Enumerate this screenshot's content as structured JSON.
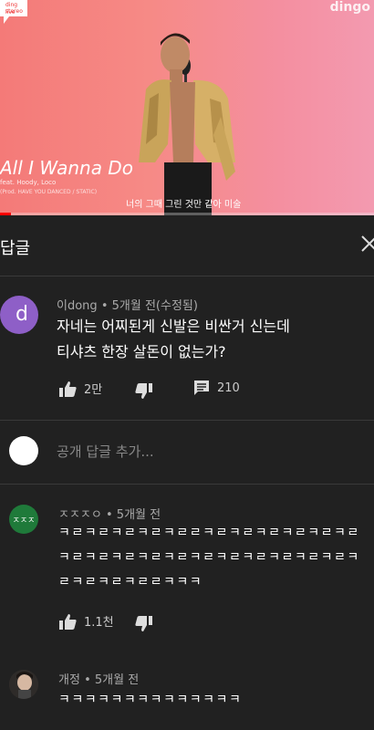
{
  "video": {
    "badge_line1": "ding stereo",
    "badge_line2": "live",
    "logo": "dingo",
    "song_title": "All I Wanna Do",
    "song_sub": "feat. Hoody, Loco",
    "song_credit": "(Prod. HAVE YOU DANCED / STATIC)",
    "subtitle": "너의 그때 그린 것만 같아 미술"
  },
  "header": {
    "title": "답글"
  },
  "main_comment": {
    "avatar_letter": "d",
    "avatar_color": "#8e5fc7",
    "author": "이dong",
    "time": "5개월 전(수정됨)",
    "line1": "자네는 어찌된게 신발은 비싼거 신는데",
    "line2": "티샤츠 한장 살돈이 없는가?",
    "likes": "2만",
    "replies": "210"
  },
  "reply_box": {
    "placeholder": "공개 답글 추가..."
  },
  "replies": [
    {
      "avatar_text": "ㅈㅈㅈ",
      "avatar_color": "#1f7a3a",
      "author": "ㅈㅈㅈㅇ",
      "time": "5개월 전",
      "line1": "ㅋㄹㅋㄹㅋㄹㅋㄹㅋㄹㄹㅋㄹㅋㄹㅋㄹㅋㄹㅋㄹㅋㄹ",
      "line2": "ㅋㄹㅋㄹㅋㄹㅋㄹㅋㄹㅋㄹㅋㄹㅋㄹㅋㄹㅋㄹㅋㄹㅋ",
      "line3": "ㄹㅋㄹㅋㄹㅋㄹㄹㅋㅋㅋ",
      "likes": "1.1천"
    },
    {
      "author": "개정",
      "time": "5개월 전",
      "line1": "ㅋㅋㅋㅋㅋㅋㅋㅋㅋㅋㅋㅋㅋㅋ"
    }
  ],
  "separator": "•"
}
